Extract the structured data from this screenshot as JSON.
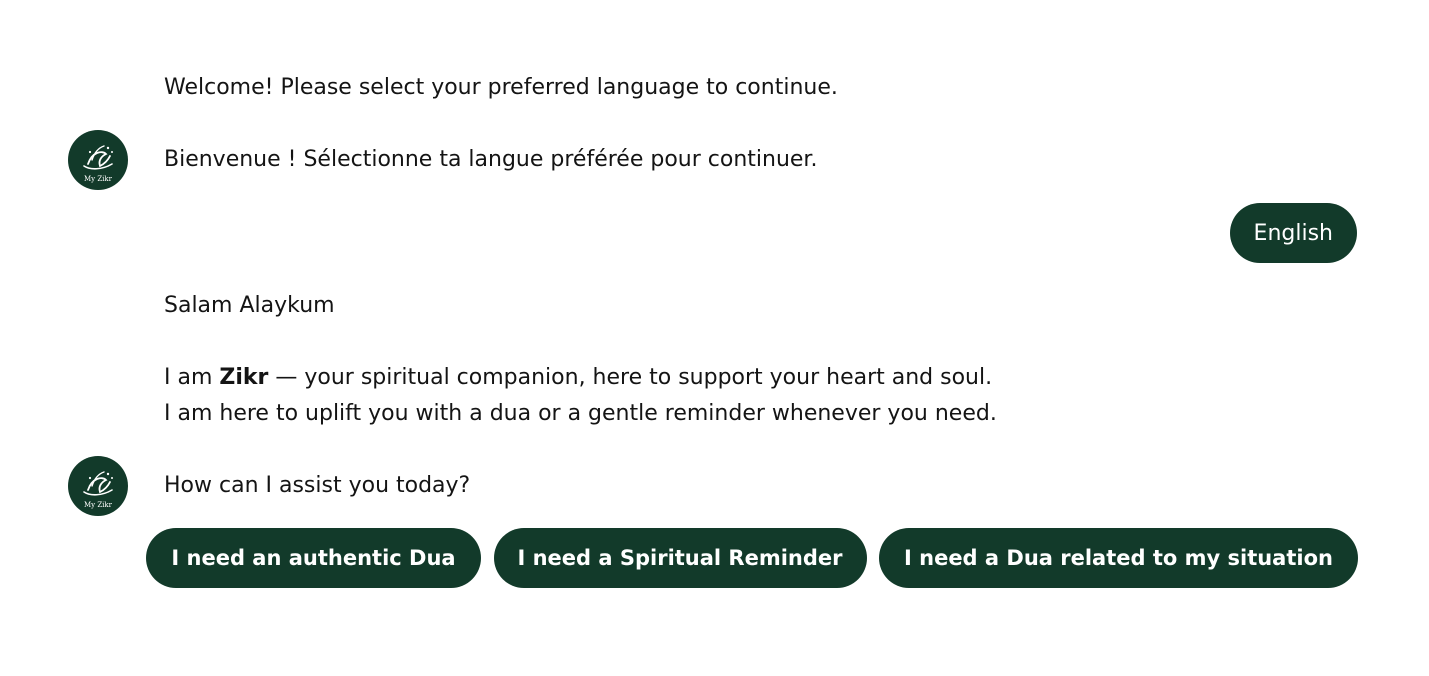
{
  "conversation": {
    "message1": {
      "line_en": "Welcome! Please select your preferred language to continue.",
      "line_fr": "Bienvenue ! Sélectionne ta langue préférée pour continuer."
    },
    "user_reply": "English",
    "message2": {
      "greeting": "Salam Alaykum",
      "intro_prefix": "I am ",
      "intro_name": "Zikr",
      "intro_suffix": " — your spiritual companion, here to support your heart and soul.",
      "uplift": "I am here to uplift you with a dua or a gentle reminder whenever you need.",
      "question": "How can I assist you today?"
    },
    "options": [
      "I need an authentic Dua",
      "I need a Spiritual Reminder",
      "I need a Dua related to my situation"
    ]
  },
  "avatar": {
    "label": "My Zikr",
    "icon": "myzikr-logo-icon",
    "background": "#123a2a"
  },
  "colors": {
    "accent": "#123a2a",
    "text": "#141414",
    "button_text": "#ffffff"
  }
}
